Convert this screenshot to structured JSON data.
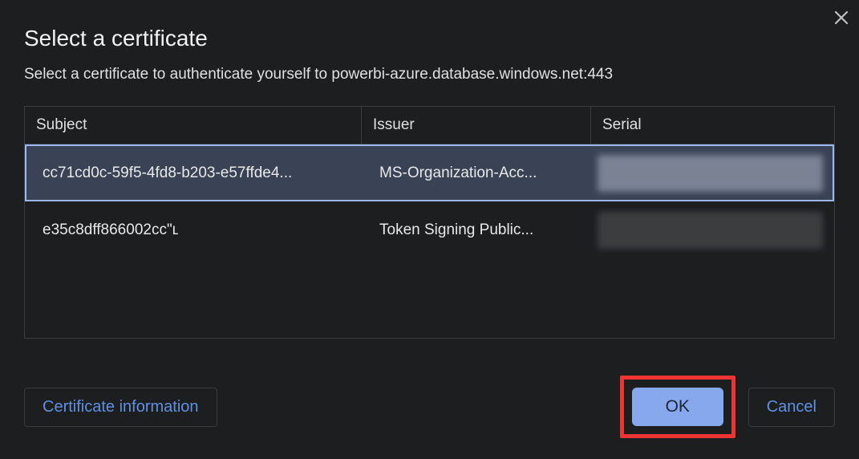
{
  "dialog": {
    "title": "Select a certificate",
    "description": "Select a certificate to authenticate yourself to powerbi-azure.database.windows.net:443"
  },
  "table": {
    "headers": {
      "subject": "Subject",
      "issuer": "Issuer",
      "serial": "Serial"
    },
    "rows": [
      {
        "subject": "cc71cd0c-59f5-4fd8-b203-e57ffde4...",
        "issuer": "MS-Organization-Acc...",
        "serial": ""
      },
      {
        "subject": "e35c8dff866002cc\"ʟ",
        "issuer": "Token Signing Public...",
        "serial": ""
      }
    ]
  },
  "buttons": {
    "certificate_information": "Certificate information",
    "ok": "OK",
    "cancel": "Cancel"
  }
}
